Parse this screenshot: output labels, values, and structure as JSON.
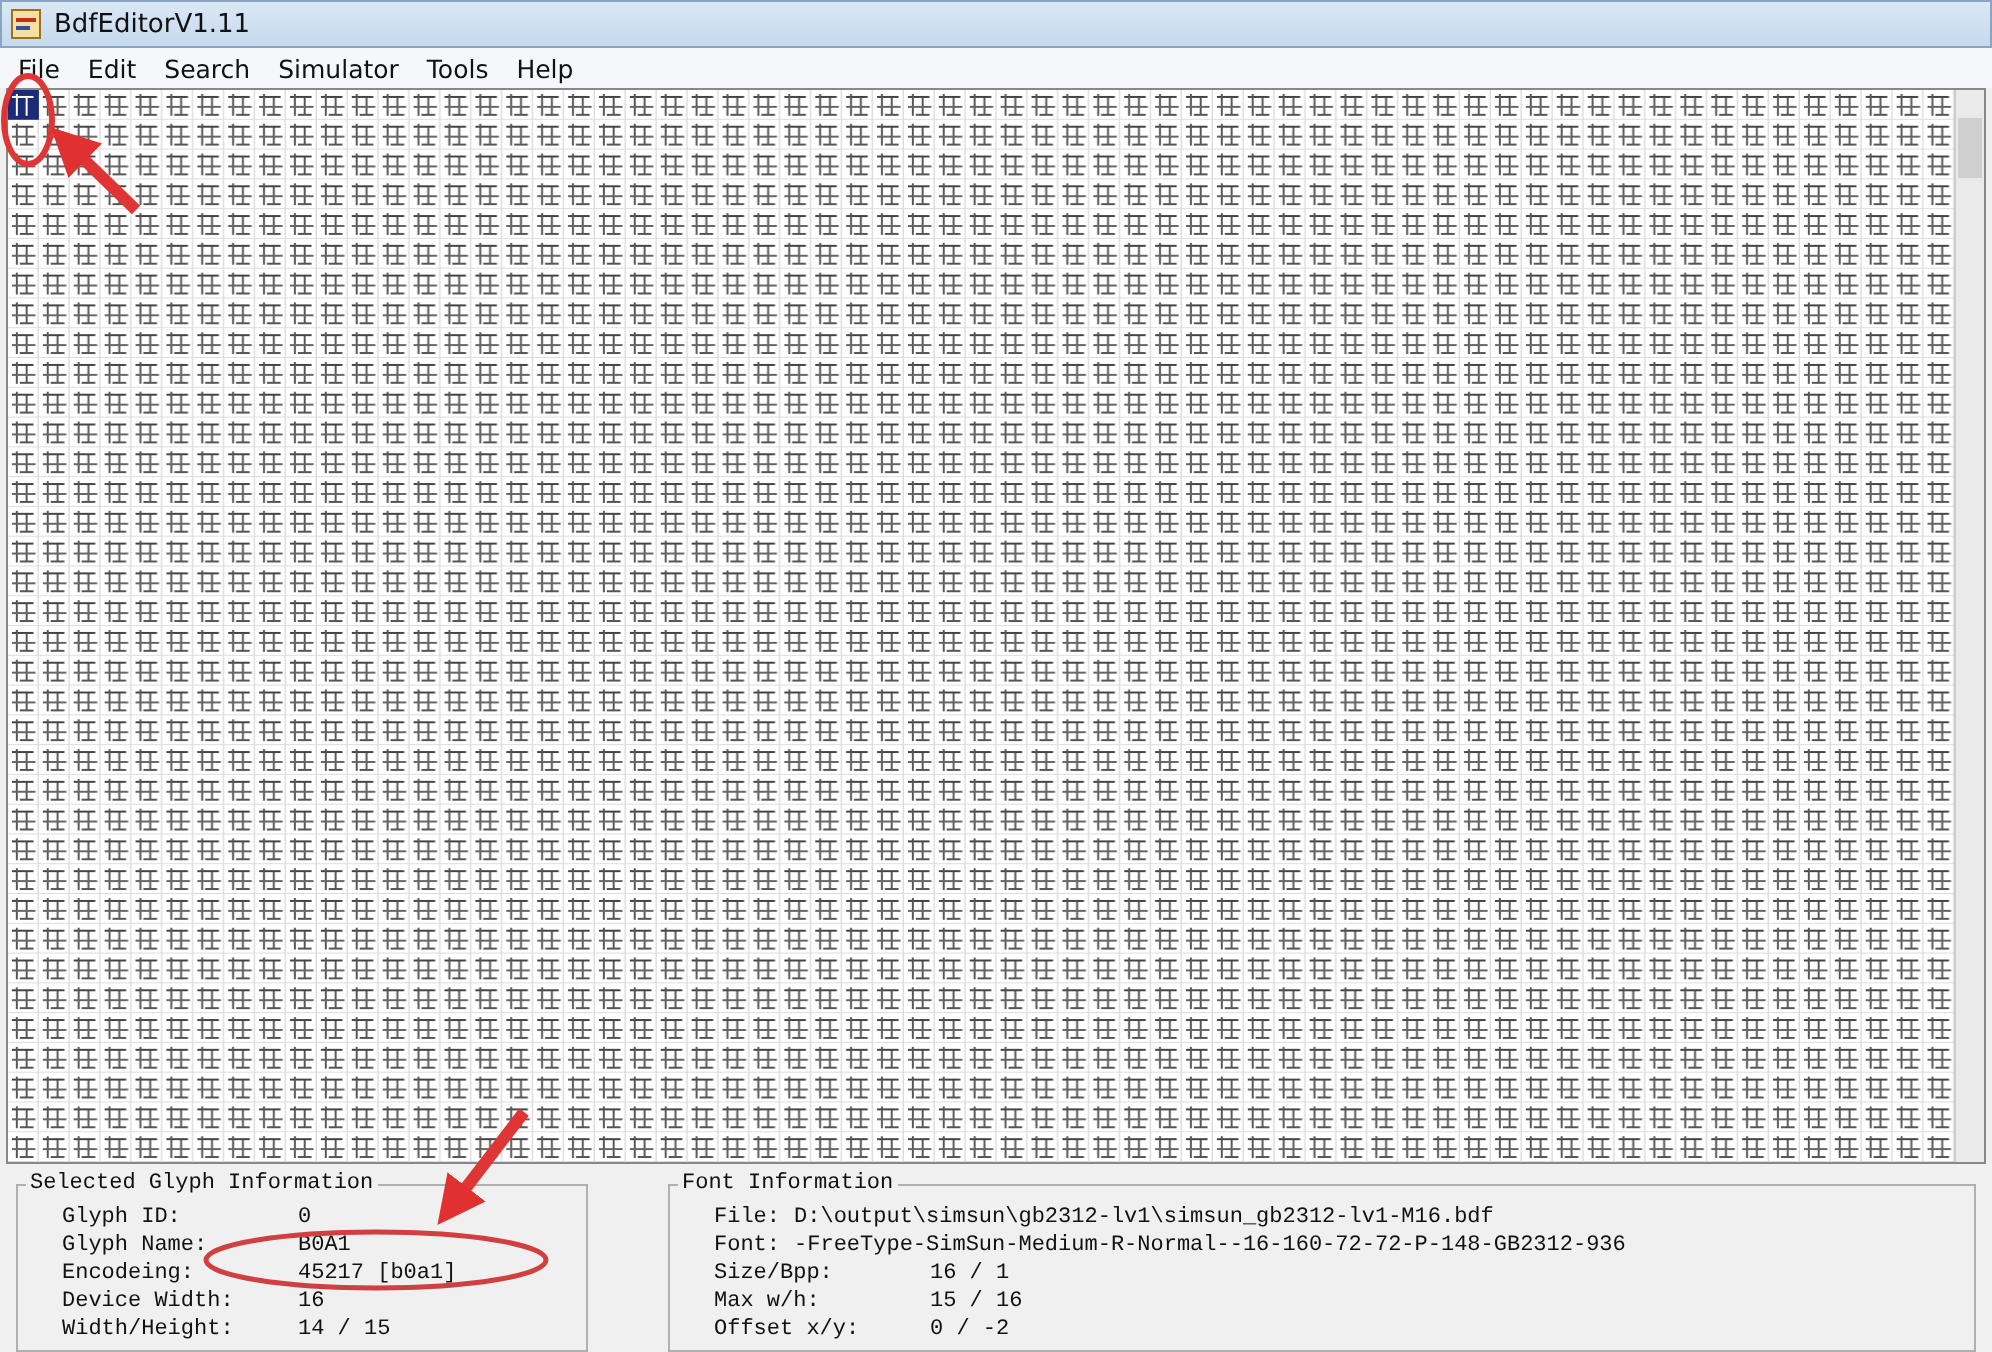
{
  "window": {
    "title": "BdfEditorV1.11"
  },
  "menu": [
    "File",
    "Edit",
    "Search",
    "Simulator",
    "Tools",
    "Help"
  ],
  "selected_glyph": {
    "title": "Selected Glyph Information",
    "fields": [
      {
        "label": "Glyph ID:",
        "value": "0"
      },
      {
        "label": "Glyph Name:",
        "value": "B0A1"
      },
      {
        "label": "Encodeing:",
        "value": "45217 [b0a1]"
      },
      {
        "label": "Device Width:",
        "value": "16"
      },
      {
        "label": "Width/Height:",
        "value": "14 / 15"
      }
    ]
  },
  "font_info": {
    "title": "Font Information",
    "fields": [
      {
        "label": "File:",
        "value": "D:\\output\\simsun\\gb2312-lv1\\simsun_gb2312-lv1-M16.bdf",
        "kind": "inline"
      },
      {
        "label": "Font:",
        "value": "-FreeType-SimSun-Medium-R-Normal--16-160-72-72-P-148-GB2312-936",
        "kind": "inline"
      },
      {
        "label": "Size/Bpp:",
        "value": "16 / 1",
        "kind": "column"
      },
      {
        "label": "Max w/h:",
        "value": "15 / 16",
        "kind": "column"
      },
      {
        "label": "Offset x/y:",
        "value": "0 / -2",
        "kind": "column"
      }
    ]
  }
}
